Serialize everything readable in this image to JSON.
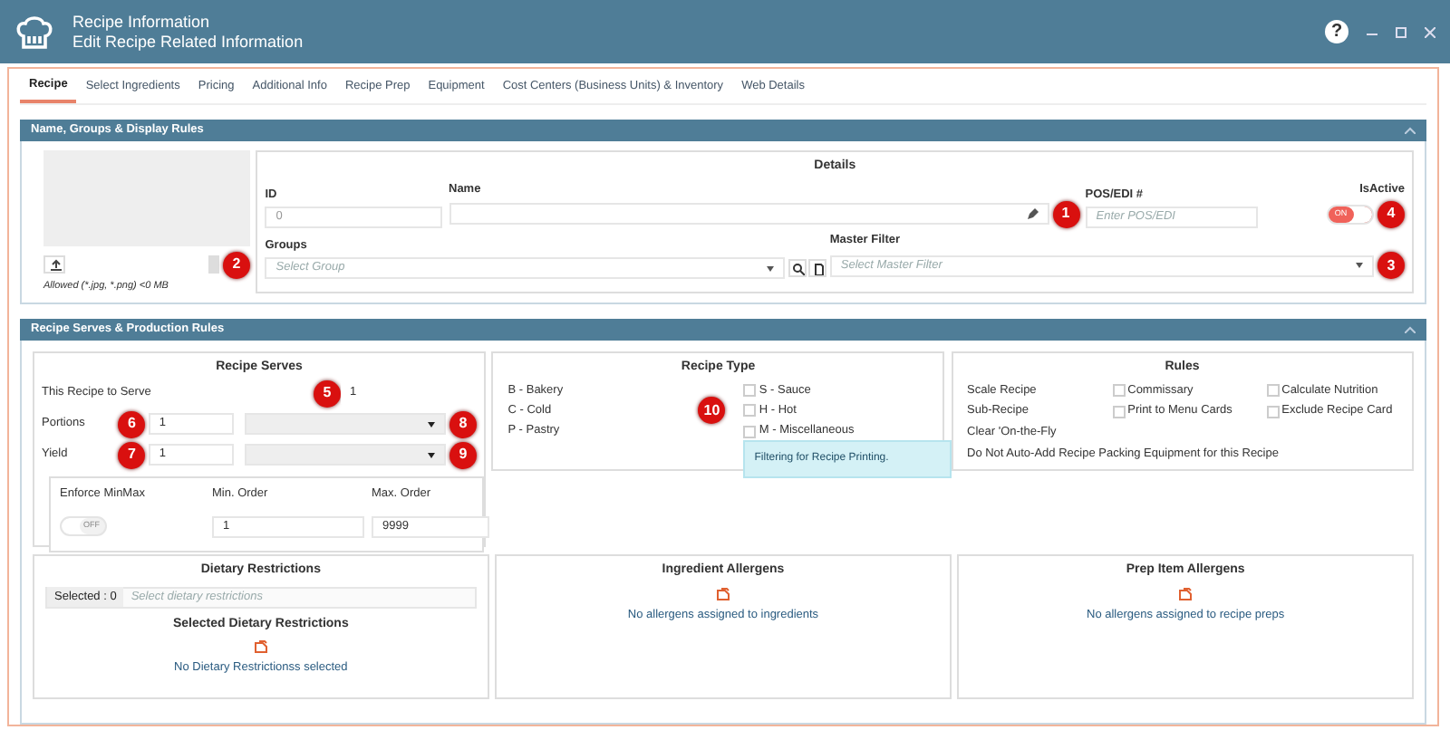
{
  "window": {
    "title": "Recipe Information",
    "subtitle": "Edit Recipe Related Information",
    "help": "?"
  },
  "tabs": [
    {
      "label": "Recipe",
      "selected": true
    },
    {
      "label": "Select Ingredients",
      "selected": false
    },
    {
      "label": "Pricing",
      "selected": false
    },
    {
      "label": "Additional Info",
      "selected": false
    },
    {
      "label": "Recipe Prep",
      "selected": false
    },
    {
      "label": "Equipment",
      "selected": false
    },
    {
      "label": "Cost Centers (Business Units) & Inventory",
      "selected": false
    },
    {
      "label": "Web Details",
      "selected": false
    }
  ],
  "section_1": {
    "title": "Name, Groups & Display Rules",
    "expanded": true,
    "image": {
      "allowed": "Allowed (*.jpg, *.png) <0 MB",
      "callout": "2"
    },
    "details": {
      "title": "Details",
      "id_label": "ID",
      "id_value": "0",
      "name_label": "Name",
      "name_callout": "1",
      "pos_label": "POS/EDI #",
      "pos_placeholder": "Enter POS/EDI",
      "active_label": "IsActive",
      "active_text": "ON",
      "active_on": true,
      "active_callout": "4",
      "groups_label": "Groups",
      "groups_placeholder": "Select Group",
      "master_label": "Master Filter",
      "master_placeholder": "Select Master Filter",
      "master_callout": "3"
    }
  },
  "section_2": {
    "title": "Recipe Serves & Production Rules",
    "expanded": true,
    "serves": {
      "title": "Recipe Serves",
      "serve_label": "This Recipe to Serve",
      "serve_callout": "5",
      "serve_value": "1",
      "rows": [
        {
          "label": "Portions",
          "callout": "6",
          "value": "1",
          "unit_callout": "8"
        },
        {
          "label": "Yield",
          "callout": "7",
          "value": "1",
          "unit_callout": "9"
        }
      ],
      "minmax": {
        "enforce_label": "Enforce MinMax",
        "enforce_text": "OFF",
        "enforce_on": false,
        "min_label": "Min. Order",
        "min_value": "1",
        "max_label": "Max. Order",
        "max_value": "9999"
      }
    },
    "recipe_type": {
      "title": "Recipe Type",
      "callout": "10",
      "left": [
        "B - Bakery",
        "C - Cold",
        "P - Pastry"
      ],
      "right": [
        {
          "label": "S - Sauce",
          "checked": false
        },
        {
          "label": "H - Hot",
          "checked": false
        },
        {
          "label": "M - Miscellaneous",
          "checked": false
        }
      ],
      "note": "Filtering for Recipe Printing."
    },
    "rules": {
      "title": "Rules",
      "items": [
        {
          "label": "Scale Recipe",
          "kind": "text"
        },
        {
          "label": "Commissary",
          "kind": "check",
          "checked": false
        },
        {
          "label": "Calculate Nutrition",
          "kind": "check",
          "checked": false
        },
        {
          "label": "Sub-Recipe",
          "kind": "text"
        },
        {
          "label": "Print to Menu Cards",
          "kind": "check",
          "checked": false
        },
        {
          "label": "Exclude Recipe Card",
          "kind": "check",
          "checked": false
        },
        {
          "label": "Clear 'On-the-Fly",
          "kind": "text"
        },
        {
          "label": "Do Not Auto-Add Recipe Packing Equipment for this Recipe",
          "kind": "wide"
        }
      ]
    },
    "dietary": {
      "title": "Dietary Restrictions",
      "selected": "Selected : 0",
      "placeholder": "Select dietary restrictions",
      "subtitle": "Selected Dietary Restrictions",
      "empty": "No Dietary Restrictionss selected"
    },
    "allergens": [
      {
        "title": "Ingredient Allergens",
        "empty": "No allergens assigned to ingredients"
      },
      {
        "title": "Prep Item Allergens",
        "empty": "No allergens assigned to recipe preps"
      }
    ]
  }
}
